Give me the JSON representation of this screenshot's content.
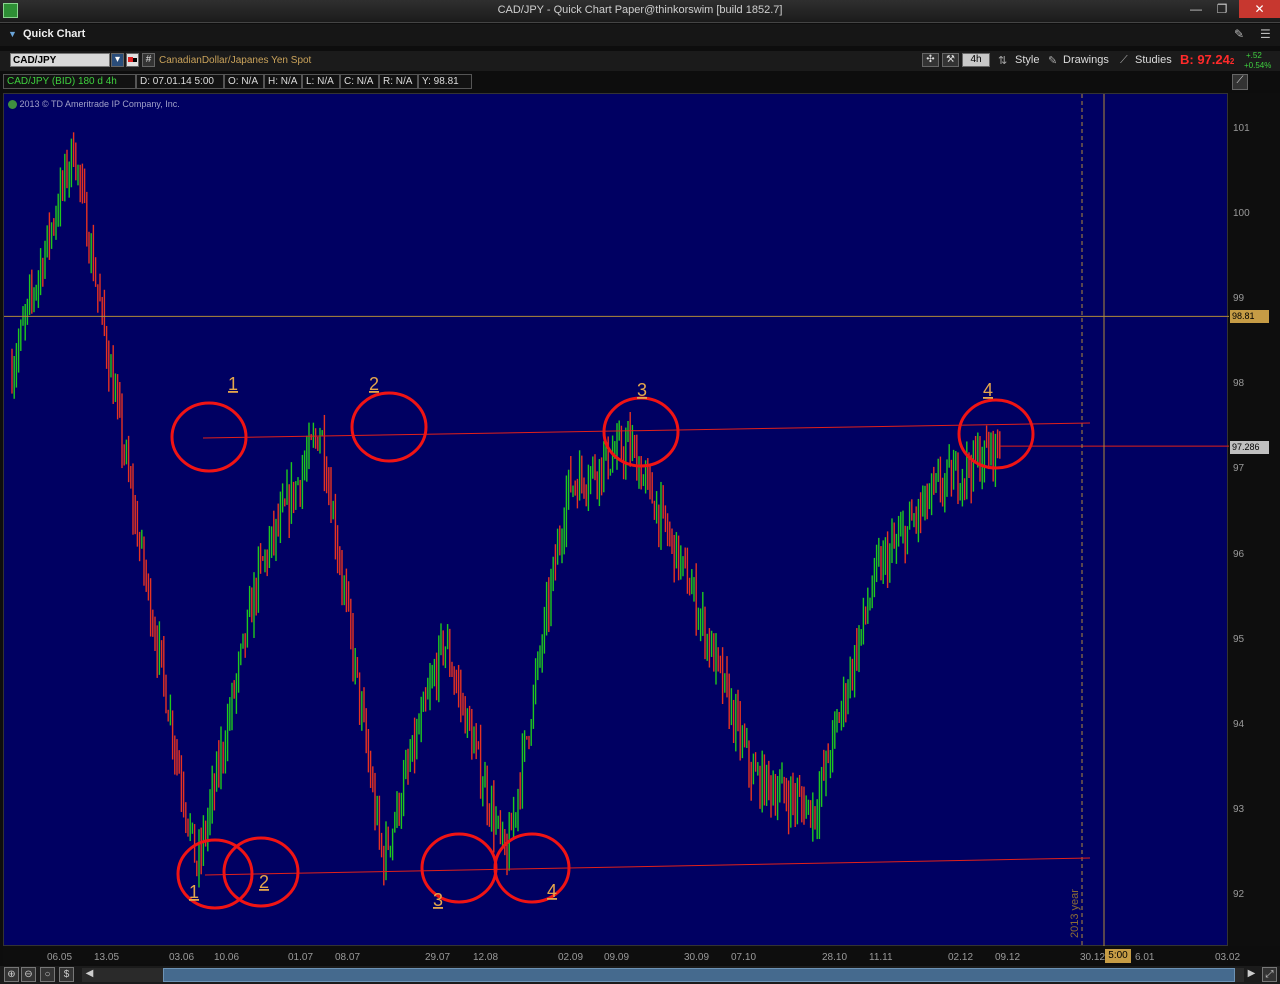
{
  "window": {
    "title": "CAD/JPY - Quick Chart Paper@thinkorswim [build 1852.7]",
    "minimize": "—",
    "maximize": "❐",
    "close": "✕"
  },
  "panel": {
    "label": "Quick Chart"
  },
  "toolbar": {
    "symbol": "CAD/JPY",
    "description": "CanadianDollar/Japanes Yen Spot",
    "aggregation": "4h",
    "style_label": "Style",
    "drawings_label": "Drawings",
    "studies_label": "Studies",
    "bid": "B: 97.24",
    "bid_suffix": "2",
    "change_abs": "+.52",
    "change_pct": "+0.54%"
  },
  "infobar": {
    "title": "CAD/JPY (BID) 180 d 4h",
    "date": "D: 07.01.14 5:00",
    "open": "O: N/A",
    "high": "H: N/A",
    "low": "L: N/A",
    "close": "C: N/A",
    "range": "R: N/A",
    "y": "Y: 98.81"
  },
  "copyright": "2013 © TD Ameritrade IP Company, Inc.",
  "yaxis": {
    "ticks": [
      "101",
      "100",
      "99",
      "98",
      "97",
      "96",
      "95",
      "94",
      "93",
      "92"
    ],
    "cursor_badge": "98.81",
    "bid_badge": "97.286"
  },
  "xaxis": {
    "ticks": [
      "06.05",
      "13.05",
      "03.06",
      "10.06",
      "01.07",
      "08.07",
      "29.07",
      "12.08",
      "02.09",
      "09.09",
      "30.09",
      "07.10",
      "28.10",
      "11.11",
      "02.12",
      "09.12",
      "30.12",
      "6.01",
      "03.02"
    ],
    "time_box": "5:00",
    "year_marker": "2013 year"
  },
  "annotations": {
    "top_labels": [
      "1",
      "2",
      "3",
      "4"
    ],
    "bottom_labels": [
      "1",
      "2",
      "3",
      "4"
    ]
  },
  "colors": {
    "chart_bg": "#000062",
    "up_bar": "#1ec81e",
    "down_bar": "#e63222",
    "trendline": "#e0201a",
    "circle": "#f01414",
    "label": "#e4a64c",
    "crosshair": "#b08a3a"
  },
  "chart_data": {
    "type": "line",
    "symbol": "CAD/JPY",
    "ylim": [
      91.8,
      101.4
    ],
    "x": [
      "06.05",
      "13.05",
      "03.06",
      "10.06",
      "01.07",
      "08.07",
      "29.07",
      "12.08",
      "02.09",
      "09.09",
      "30.09",
      "07.10",
      "28.10",
      "11.11",
      "02.12",
      "09.12"
    ],
    "series": [
      {
        "values": [
          98.2,
          100.8,
          96.4,
          92.3,
          95.8,
          97.5,
          92.4,
          95.0,
          92.4,
          96.8,
          97.3,
          95.6,
          93.4,
          93.0,
          95.8,
          96.8,
          97.3
        ]
      }
    ],
    "trendlines": [
      {
        "from": [
          92.3,
          97.35
        ],
        "to": [
          97.3,
          97.6
        ]
      },
      {
        "from": [
          92.2,
          92.25
        ],
        "to": [
          92.4,
          92.45
        ]
      }
    ],
    "crosshair_y": 98.81,
    "bid_line": 97.286
  }
}
